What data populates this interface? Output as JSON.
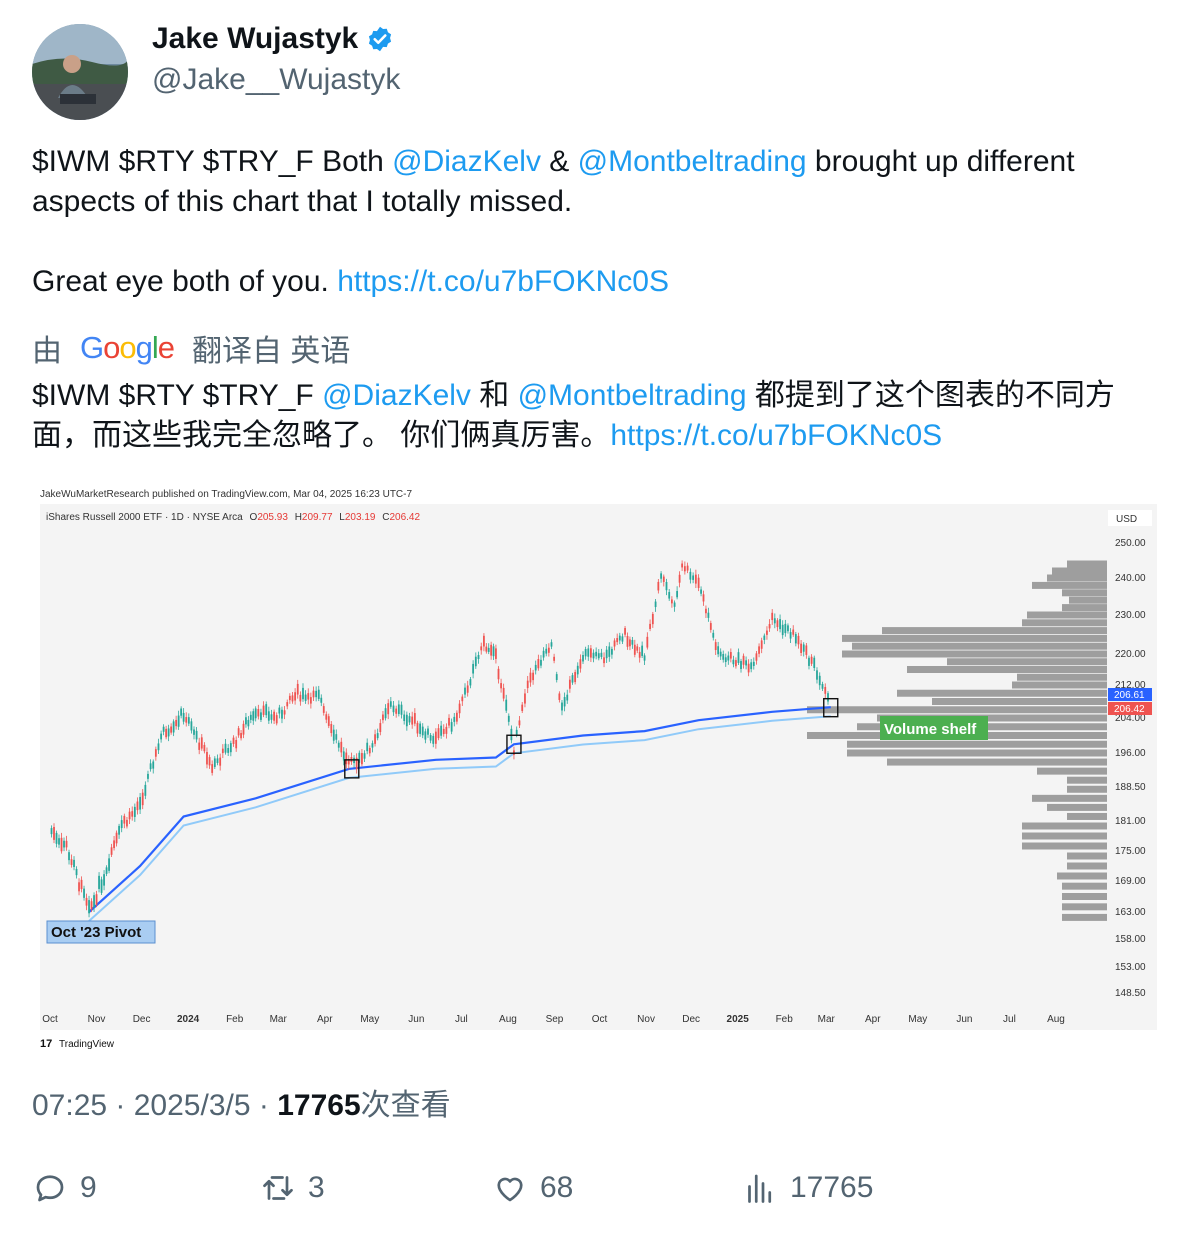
{
  "author": {
    "name": "Jake Wujastyk",
    "handle": "@Jake__Wujastyk"
  },
  "tweet": {
    "line1_part1": "$IWM $RTY $TRY_F Both ",
    "mention1": "@DiazKelv",
    "line1_part2": " & ",
    "mention2": "@Montbeltrading",
    "line1_part3": " brought up different aspects of this chart that I totally missed.",
    "line2_part1": "Great eye both of you. ",
    "link": "https://t.co/u7bFOKNc0S"
  },
  "translation": {
    "prefix": "由",
    "provider": "Google",
    "suffix": "翻译自 英语",
    "part1": "$IWM $RTY $TRY_F ",
    "mention1": "@DiazKelv",
    "part2": " 和 ",
    "mention2": "@Montbeltrading",
    "part3": " 都提到了这个图表的不同方面，而这些我完全忽略了。 你们俩真厉害。",
    "link": "https://t.co/u7bFOKNc0S"
  },
  "chart_image": {
    "publisher": "JakeWuMarketResearch published on TradingView.com, Mar 04, 2025 16:23 UTC-7",
    "symbol_line": "iShares Russell 2000 ETF · 1D · NYSE Arca",
    "ohlc": {
      "o_label": "O",
      "o": "205.93",
      "h_label": "H",
      "h": "209.77",
      "l_label": "L",
      "l": "203.19",
      "c_label": "C",
      "c": "206.42"
    },
    "currency": "USD",
    "price_ticks": [
      "250.00",
      "240.00",
      "230.00",
      "220.00",
      "212.00",
      "204.00",
      "196.00",
      "188.50",
      "181.00",
      "175.00",
      "169.00",
      "163.00",
      "158.00",
      "153.00",
      "148.50"
    ],
    "price_badge_blue": "206.61",
    "price_badge_red": "206.42",
    "x_ticks": [
      "Oct",
      "Nov",
      "Dec",
      "2024",
      "Feb",
      "Mar",
      "Apr",
      "May",
      "Jun",
      "Jul",
      "Aug",
      "Sep",
      "Oct",
      "Nov",
      "Dec",
      "2025",
      "Feb",
      "Mar",
      "Apr",
      "May",
      "Jun",
      "Jul",
      "Aug"
    ],
    "annotation_pivot": "Oct '23 Pivot",
    "annotation_shelf": "Volume shelf",
    "watermark": "TradingView",
    "colors": {
      "up": "#26a69a",
      "down": "#ef5350",
      "avwap": "#2962ff",
      "band": "#90caf9",
      "volume": "#9e9e9e",
      "shelf": "#4caf50"
    },
    "price_path": [
      [
        "2023-10-02",
        179
      ],
      [
        "2023-10-12",
        176
      ],
      [
        "2023-10-27",
        163
      ],
      [
        "2023-11-06",
        170
      ],
      [
        "2023-11-16",
        180
      ],
      [
        "2023-11-30",
        184
      ],
      [
        "2023-12-14",
        200
      ],
      [
        "2023-12-29",
        205
      ],
      [
        "2024-01-17",
        193
      ],
      [
        "2024-02-02",
        199
      ],
      [
        "2024-02-15",
        206
      ],
      [
        "2024-02-29",
        204
      ],
      [
        "2024-03-14",
        210
      ],
      [
        "2024-03-28",
        209
      ],
      [
        "2024-04-17",
        193
      ],
      [
        "2024-05-01",
        197
      ],
      [
        "2024-05-15",
        207
      ],
      [
        "2024-05-31",
        203
      ],
      [
        "2024-06-14",
        199
      ],
      [
        "2024-06-28",
        204
      ],
      [
        "2024-07-16",
        223
      ],
      [
        "2024-07-24",
        219
      ],
      [
        "2024-08-05",
        197
      ],
      [
        "2024-08-16",
        214
      ],
      [
        "2024-08-30",
        222
      ],
      [
        "2024-09-06",
        206
      ],
      [
        "2024-09-20",
        220
      ],
      [
        "2024-10-04",
        219
      ],
      [
        "2024-10-18",
        225
      ],
      [
        "2024-10-31",
        219
      ],
      [
        "2024-11-11",
        241
      ],
      [
        "2024-11-20",
        232
      ],
      [
        "2024-11-25",
        244
      ],
      [
        "2024-12-06",
        239
      ],
      [
        "2024-12-19",
        220
      ],
      [
        "2025-01-10",
        217
      ],
      [
        "2025-01-24",
        229
      ],
      [
        "2025-02-07",
        225
      ],
      [
        "2025-02-21",
        217
      ],
      [
        "2025-03-04",
        206.42
      ]
    ],
    "avwap_path": [
      [
        "2023-10-27",
        163
      ],
      [
        "2023-11-30",
        172
      ],
      [
        "2023-12-29",
        182
      ],
      [
        "2024-02-15",
        186
      ],
      [
        "2024-04-17",
        192.5
      ],
      [
        "2024-06-14",
        194.5
      ],
      [
        "2024-07-24",
        195
      ],
      [
        "2024-08-05",
        198
      ],
      [
        "2024-09-20",
        200
      ],
      [
        "2024-10-31",
        201
      ],
      [
        "2024-12-06",
        203.5
      ],
      [
        "2025-01-24",
        205.5
      ],
      [
        "2025-03-04",
        206.61
      ]
    ],
    "volume_profile": [
      [
        244,
        40
      ],
      [
        242,
        55
      ],
      [
        240,
        60
      ],
      [
        238,
        75
      ],
      [
        236,
        45
      ],
      [
        234,
        38
      ],
      [
        232,
        45
      ],
      [
        230,
        80
      ],
      [
        228,
        85
      ],
      [
        226,
        225
      ],
      [
        224,
        265
      ],
      [
        222,
        255
      ],
      [
        220,
        265
      ],
      [
        218,
        160
      ],
      [
        216,
        200
      ],
      [
        214,
        90
      ],
      [
        212,
        95
      ],
      [
        210,
        210
      ],
      [
        208,
        175
      ],
      [
        206,
        300
      ],
      [
        204,
        230
      ],
      [
        202,
        250
      ],
      [
        200,
        300
      ],
      [
        198,
        260
      ],
      [
        196,
        260
      ],
      [
        194,
        220
      ],
      [
        192,
        70
      ],
      [
        190,
        40
      ],
      [
        188,
        40
      ],
      [
        186,
        75
      ],
      [
        184,
        60
      ],
      [
        182,
        40
      ],
      [
        180,
        85
      ],
      [
        178,
        85
      ],
      [
        176,
        85
      ],
      [
        174,
        40
      ],
      [
        172,
        40
      ],
      [
        170,
        50
      ],
      [
        168,
        45
      ],
      [
        166,
        45
      ],
      [
        164,
        45
      ],
      [
        162,
        45
      ]
    ],
    "boxes": [
      [
        "2024-04-19",
        192.5
      ],
      [
        "2024-08-05",
        198
      ],
      [
        "2025-03-04",
        206.5
      ]
    ]
  },
  "meta": {
    "time": "07:25",
    "sep1": " · ",
    "date": "2025/3/5",
    "sep2": " · ",
    "views_count": "17765",
    "views_label": "次查看"
  },
  "actions": {
    "replies": "9",
    "retweets": "3",
    "likes": "68",
    "views": "17765"
  }
}
